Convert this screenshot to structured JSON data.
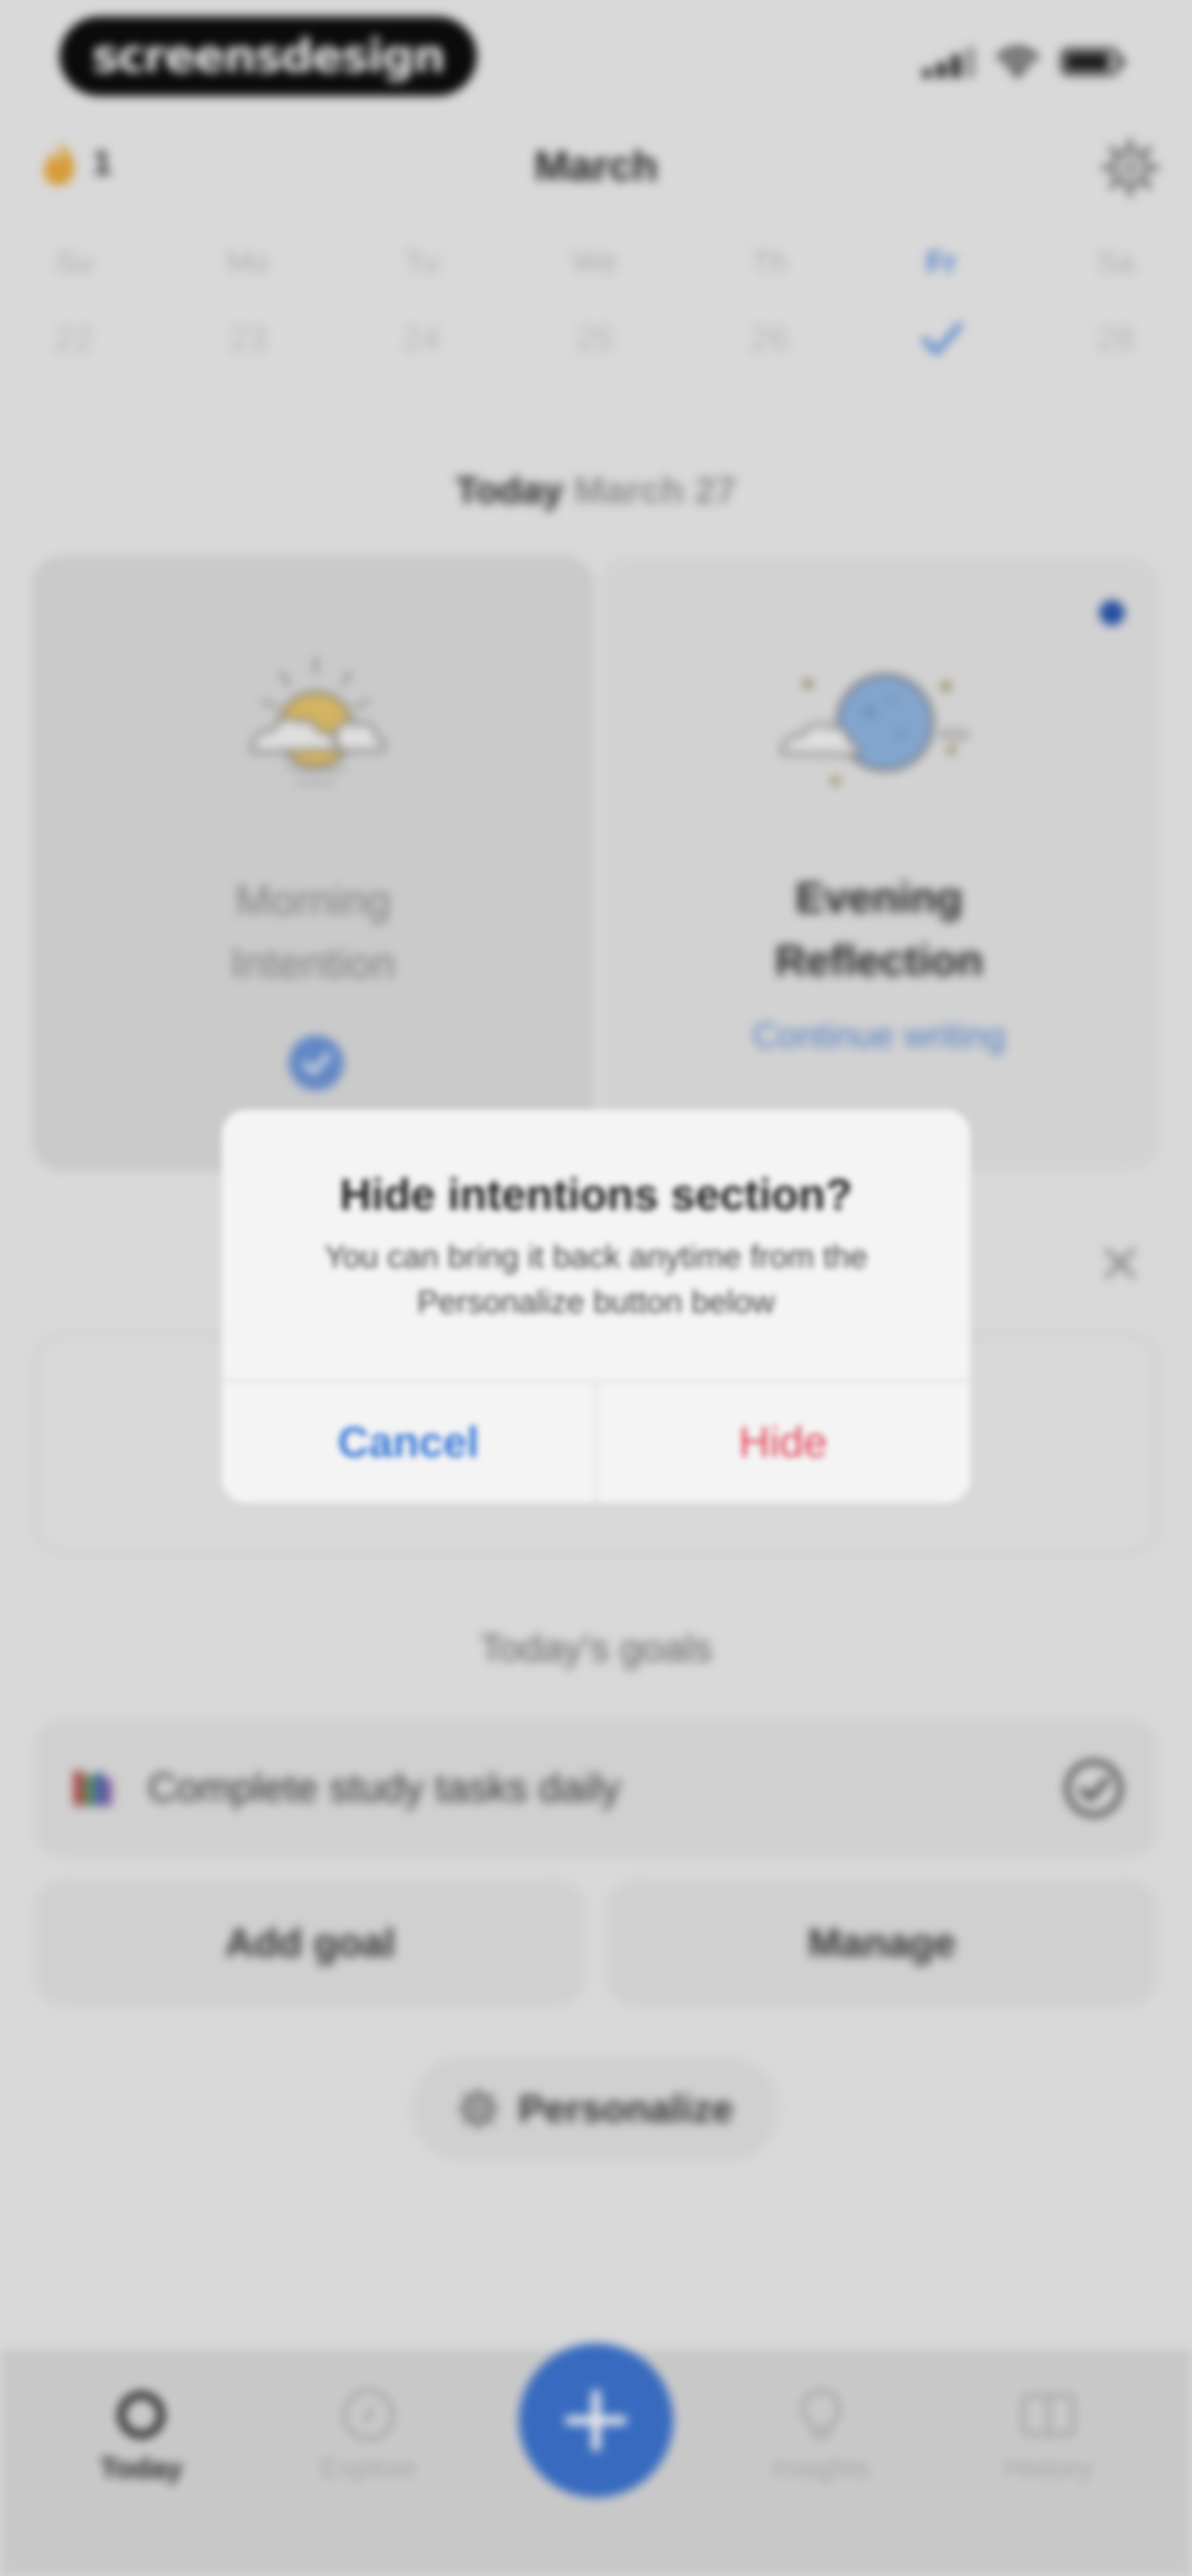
{
  "status_bar": {
    "brand": "screensdesign"
  },
  "header": {
    "streak_count": "1",
    "month": "March"
  },
  "calendar": {
    "weekdays": [
      "Su",
      "Mo",
      "Tu",
      "We",
      "Th",
      "Fr",
      "Sa"
    ],
    "dates": [
      "22",
      "23",
      "24",
      "25",
      "26",
      "",
      "28"
    ],
    "selected_index": 5
  },
  "today": {
    "label": "Today",
    "date": "March 27"
  },
  "intentions": {
    "morning": {
      "title_line1": "Morning",
      "title_line2": "Intention",
      "completed": true
    },
    "evening": {
      "title_line1": "Evening",
      "title_line2": "Reflection",
      "link": "Continue writing",
      "unread": true
    }
  },
  "dialog": {
    "title": "Hide intentions section?",
    "message_line1": "You can bring it back anytime from the",
    "message_line2": "Personalize button below",
    "cancel_label": "Cancel",
    "confirm_label": "Hide"
  },
  "goals": {
    "title": "Today's goals",
    "items": [
      {
        "label": "Complete study tasks daily",
        "icon": "books-icon",
        "done": true
      }
    ],
    "add_label": "Add goal",
    "manage_label": "Manage"
  },
  "personalize_label": "Personalize",
  "tabs": [
    {
      "label": "Today",
      "icon": "circle-icon",
      "active": true
    },
    {
      "label": "Explore",
      "icon": "compass-icon",
      "active": false
    },
    {
      "label": "Insights",
      "icon": "lightbulb-icon",
      "active": false
    },
    {
      "label": "History",
      "icon": "book-icon",
      "active": false
    }
  ],
  "fab": {
    "icon": "plus-icon"
  },
  "colors": {
    "accent": "#3d74d0",
    "link": "#5b8ad2",
    "destructive": "#e2445a",
    "streak_flame": "#e9a93a",
    "sun": "#e6c46a",
    "moon": "#8fb3df"
  }
}
